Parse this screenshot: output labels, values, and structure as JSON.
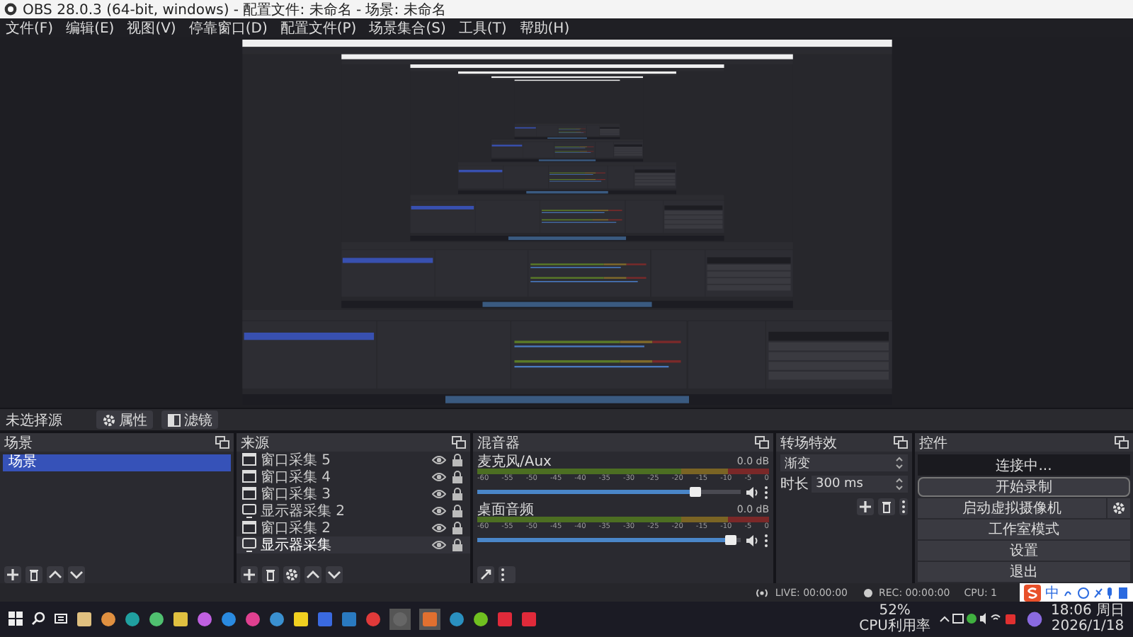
{
  "window": {
    "title": "OBS 28.0.3 (64-bit, windows) - 配置文件: 未命名 - 场景: 未命名"
  },
  "menu": [
    "文件(F)",
    "编辑(E)",
    "视图(V)",
    "停靠窗口(D)",
    "配置文件(P)",
    "场景集合(S)",
    "工具(T)",
    "帮助(H)"
  ],
  "context_bar": {
    "label": "未选择源",
    "buttons": [
      {
        "label": "属性",
        "kind": "properties"
      },
      {
        "label": "滤镜",
        "kind": "filters"
      }
    ]
  },
  "scenes": {
    "title": "场景",
    "items": [
      {
        "label": "场景",
        "selected": true
      }
    ]
  },
  "sources": {
    "title": "来源",
    "items": [
      {
        "label": "窗口采集 5",
        "kind": "window",
        "selected": false
      },
      {
        "label": "窗口采集 4",
        "kind": "window",
        "selected": false
      },
      {
        "label": "窗口采集 3",
        "kind": "window",
        "selected": false
      },
      {
        "label": "显示器采集 2",
        "kind": "monitor",
        "selected": false
      },
      {
        "label": "窗口采集 2",
        "kind": "window",
        "selected": false
      },
      {
        "label": "显示器采集",
        "kind": "monitor",
        "selected": true
      }
    ]
  },
  "mixer": {
    "title": "混音器",
    "channels": [
      {
        "name": "麦克风/Aux",
        "reading": "0.0 dB",
        "level": 0.83,
        "scale": [
          "-60",
          "-55",
          "-50",
          "-45",
          "-40",
          "-35",
          "-30",
          "-25",
          "-20",
          "-15",
          "-10",
          "-5",
          "0"
        ]
      },
      {
        "name": "桌面音频",
        "reading": "0.0 dB",
        "level": 0.96,
        "scale": [
          "-60",
          "-55",
          "-50",
          "-45",
          "-40",
          "-35",
          "-30",
          "-25",
          "-20",
          "-15",
          "-10",
          "-5",
          "0"
        ]
      }
    ]
  },
  "transitions": {
    "title": "转场特效",
    "transition": "渐变",
    "duration_label": "时长",
    "duration": "300 ms"
  },
  "controls": {
    "title": "控件",
    "buttons": [
      {
        "label": "连接中...",
        "kind": "busy"
      },
      {
        "label": "开始录制",
        "kind": "record"
      },
      {
        "label": "启动虚拟摄像机",
        "kind": "virtualcam"
      },
      {
        "label": "工作室模式",
        "kind": "plain"
      },
      {
        "label": "设置",
        "kind": "plain"
      },
      {
        "label": "退出",
        "kind": "plain"
      }
    ]
  },
  "status_bar": {
    "live": "LIVE: 00:00:00",
    "rec": "REC: 00:00:00",
    "cpu": "CPU: 1"
  },
  "ime": {
    "mode": "中"
  },
  "taskbar": {
    "cpu_percent": "52%",
    "cpu_label": "CPU利用率",
    "time": "18:06 周日",
    "date": "2026/1/18"
  }
}
